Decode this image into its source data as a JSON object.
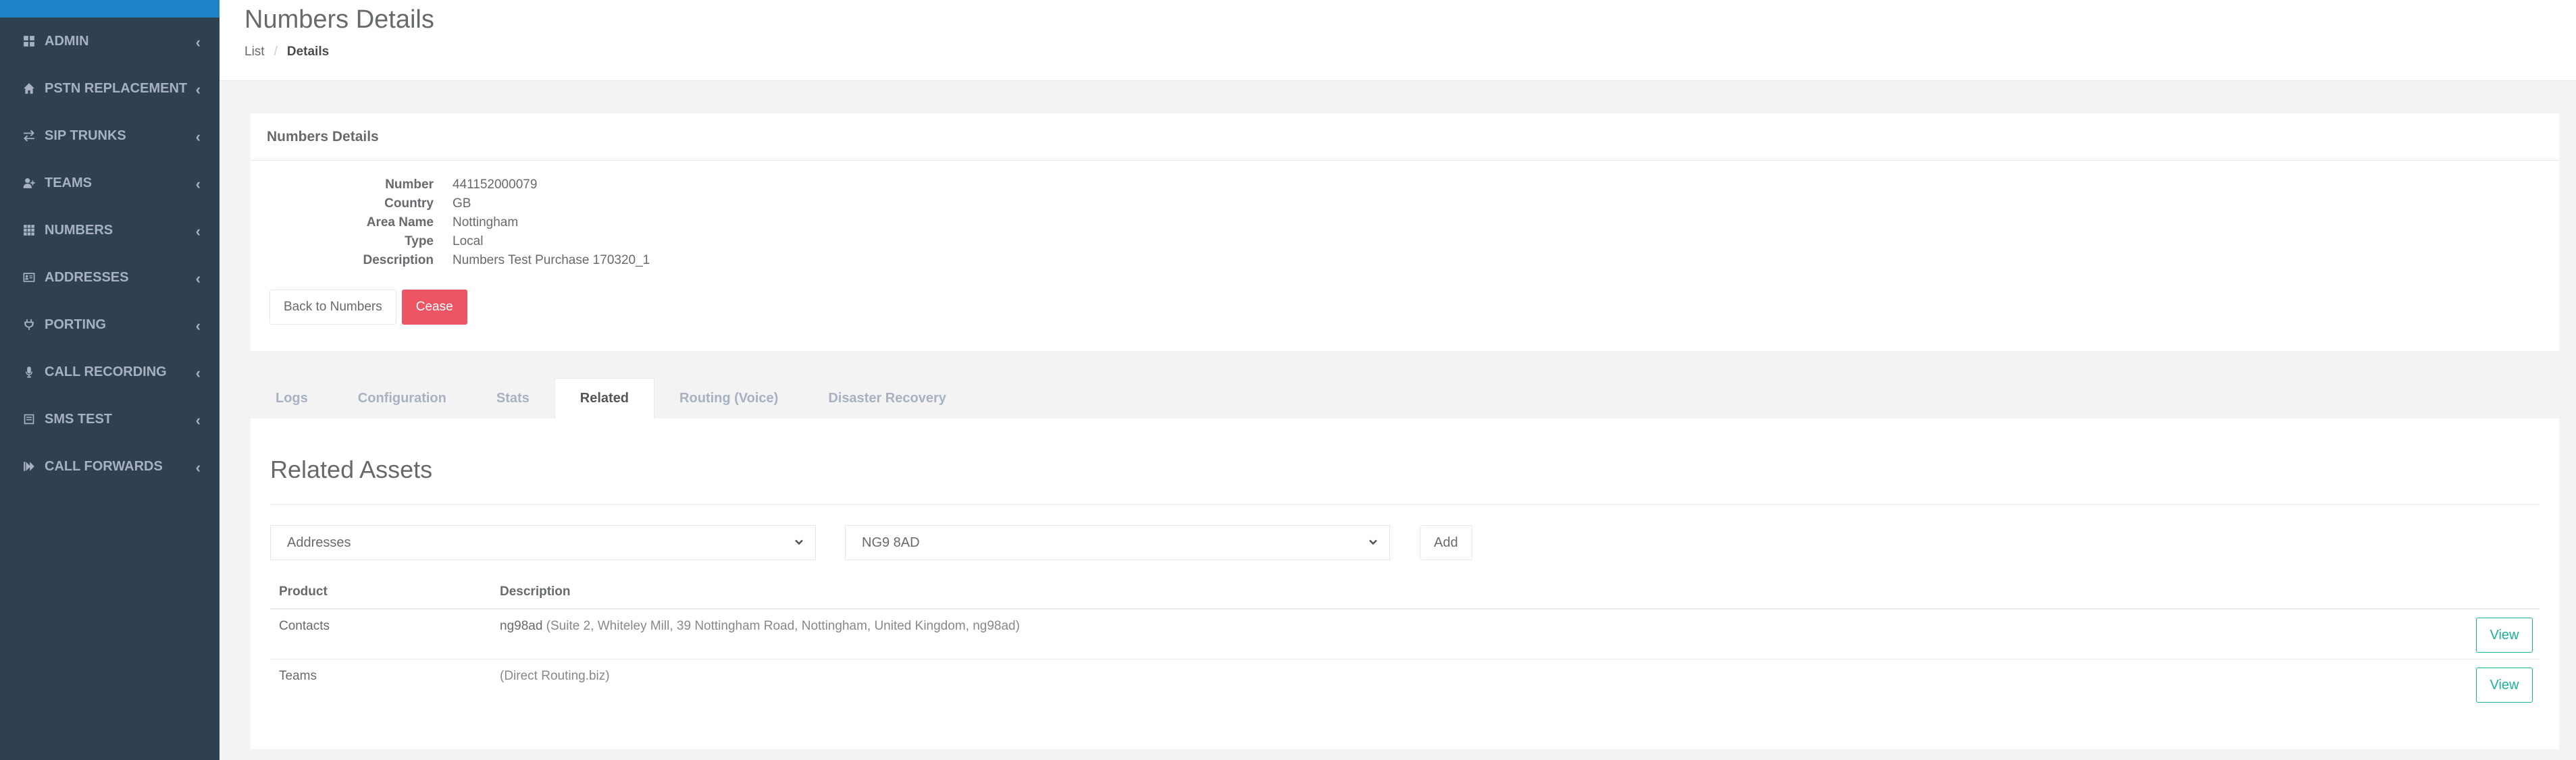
{
  "sidebar": {
    "items": [
      {
        "label": "ADMIN",
        "icon": "grid-icon"
      },
      {
        "label": "PSTN REPLACEMENT",
        "icon": "home-icon"
      },
      {
        "label": "SIP TRUNKS",
        "icon": "exchange-icon"
      },
      {
        "label": "TEAMS",
        "icon": "user-plus-icon"
      },
      {
        "label": "NUMBERS",
        "icon": "th-icon"
      },
      {
        "label": "ADDRESSES",
        "icon": "address-card-icon"
      },
      {
        "label": "PORTING",
        "icon": "plug-icon"
      },
      {
        "label": "CALL RECORDING",
        "icon": "microphone-icon"
      },
      {
        "label": "SMS TEST",
        "icon": "sms-icon"
      },
      {
        "label": "CALL FORWARDS",
        "icon": "forward-icon"
      }
    ]
  },
  "header": {
    "title": "Numbers Details",
    "breadcrumb": {
      "parent": "List",
      "separator": "/",
      "current": "Details"
    }
  },
  "details": {
    "title": "Numbers Details",
    "fields": [
      {
        "label": "Number",
        "value": "441152000079"
      },
      {
        "label": "Country",
        "value": "GB"
      },
      {
        "label": "Area Name",
        "value": "Nottingham"
      },
      {
        "label": "Type",
        "value": "Local"
      },
      {
        "label": "Description",
        "value": "Numbers Test Purchase 170320_1"
      }
    ],
    "back_label": "Back to Numbers",
    "cease_label": "Cease"
  },
  "tabs": [
    {
      "label": "Logs",
      "active": false
    },
    {
      "label": "Configuration",
      "active": false
    },
    {
      "label": "Stats",
      "active": false
    },
    {
      "label": "Related",
      "active": true
    },
    {
      "label": "Routing (Voice)",
      "active": false
    },
    {
      "label": "Disaster Recovery",
      "active": false
    }
  ],
  "related": {
    "title": "Related Assets",
    "type_select": "Addresses",
    "value_select": "NG9 8AD",
    "add_label": "Add",
    "columns": {
      "product": "Product",
      "description": "Description"
    },
    "rows": [
      {
        "product": "Contacts",
        "desc_main": "ng98ad",
        "desc_sub": " (Suite 2, Whiteley Mill, 39 Nottingham Road, Nottingham, United Kingdom, ng98ad)",
        "action": "View"
      },
      {
        "product": "Teams",
        "desc_main": "",
        "desc_sub": "(Direct Routing.biz)",
        "action": "View"
      }
    ]
  },
  "colors": {
    "sidebar": "#2f4050",
    "sidebar_accent": "#1c84c6",
    "danger": "#ed5565",
    "primary": "#1ab394"
  }
}
